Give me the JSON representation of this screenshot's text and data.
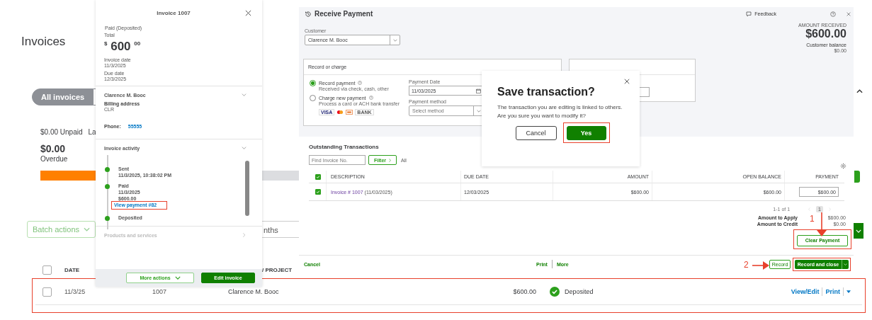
{
  "invoices_page": {
    "title": "Invoices",
    "tabs": [
      {
        "label": "All invoices",
        "selected": true
      }
    ],
    "unpaid": "$0.00 Unpaid",
    "unpaid_next": "La",
    "overdue_amount": "$0.00",
    "overdue_label": "Overdue",
    "batch_button": "Batch actions",
    "date_filter": "nths",
    "table": {
      "header_checked": false,
      "columns": [
        "DATE",
        "/ PROJECT"
      ],
      "rows": [
        {
          "checked": false,
          "highlighted": true,
          "date": "11/3/25",
          "number": "1007",
          "customer": "Clarence M. Booc",
          "amount": "$600.00",
          "status": "Deposited",
          "actions": [
            "View/Edit",
            "Print"
          ]
        }
      ]
    }
  },
  "invoice_panel": {
    "title": "Invoice 1007",
    "status": "Paid (Deposited)",
    "total_label": "Total",
    "total_currency": "$",
    "total_whole": "600",
    "total_cents": "00",
    "invoice_date_label": "Invoice date",
    "invoice_date": "11/3/2025",
    "due_date_label": "Due date",
    "due_date": "12/3/2025",
    "customer": {
      "name": "Clarence M. Booc",
      "expanded": true,
      "billing_label": "Billing address",
      "billing": "CLR",
      "phone_label": "Phone:",
      "phone": "55555"
    },
    "activity": {
      "title": "Invoice activity",
      "expanded": true,
      "events": [
        {
          "title": "Sent",
          "lines": [
            "11/3/2025, 10:38:02 PM"
          ]
        },
        {
          "title": "Paid",
          "lines": [
            "11/3/2025",
            "$600.00"
          ],
          "link": "View payment #82",
          "link_highlighted": true
        },
        {
          "title": "Deposited"
        }
      ]
    },
    "products": {
      "title": "Products and services",
      "expanded": false,
      "disabled": true
    },
    "buttons": [
      {
        "kind": "secondary",
        "label": "More actions"
      },
      {
        "kind": "primary",
        "label": "Edit invoice"
      }
    ]
  },
  "receive_payment": {
    "title": "Receive Payment",
    "feedback": "Feedback",
    "customer_label": "Customer",
    "customer": "Clarence M. Booc",
    "amount_label": "AMOUNT RECEIVED",
    "amount": "$600.00",
    "balance_label": "Customer balance",
    "balance": "$0.00",
    "record_card": {
      "title": "Record or charge",
      "options": [
        {
          "label": "Record payment",
          "hint": "Received via check, cash, other",
          "selected": true
        },
        {
          "label": "Charge new payment",
          "hint": "Process a card or ACH bank transfer",
          "selected": false
        }
      ],
      "cards": [
        "VISA",
        "BANK"
      ],
      "date_label": "Payment Date",
      "date": "11/03/2025",
      "method_label": "Payment method",
      "method_placeholder": "Select method"
    },
    "outstanding": {
      "title": "Outstanding Transactions",
      "search_placeholder": "Find Invoice No.",
      "filter": "Filter",
      "filter_value": "All",
      "all_checked": true,
      "columns": [
        "DESCRIPTION",
        "DUE DATE",
        "AMOUNT",
        "OPEN BALANCE",
        "PAYMENT"
      ],
      "rows": [
        {
          "checked": true,
          "description": "Invoice # 1007",
          "date_note": "(11/03/2025)",
          "due_date": "12/03/2025",
          "amount": "$600.00",
          "open_balance": "$600.00",
          "payment": "$600.00"
        }
      ],
      "pager_text": "1-1 of 1",
      "pages": [
        {
          "label": "1",
          "selected": true
        }
      ]
    },
    "totals": [
      {
        "label": "Amount to Apply",
        "value": "$600.00"
      },
      {
        "label": "Amount to Credit",
        "value": "$0.00"
      }
    ],
    "clear_button": {
      "label": "Clear Payment",
      "highlighted": true
    },
    "footer": {
      "cancel": "Cancel",
      "print": "Print",
      "more": "More",
      "save": "Record",
      "save_close": "Record and close",
      "save_close_highlighted": true
    }
  },
  "dialog": {
    "title": "Save transaction?",
    "message": "The transaction you are editing is linked to others. Are you sure you want to modify it?",
    "buttons": [
      {
        "kind": "secondary",
        "label": "Cancel",
        "highlighted": false
      },
      {
        "kind": "primary",
        "label": "Yes",
        "highlighted": true
      }
    ]
  },
  "callouts": [
    {
      "label": "1"
    },
    {
      "label": "2"
    }
  ]
}
